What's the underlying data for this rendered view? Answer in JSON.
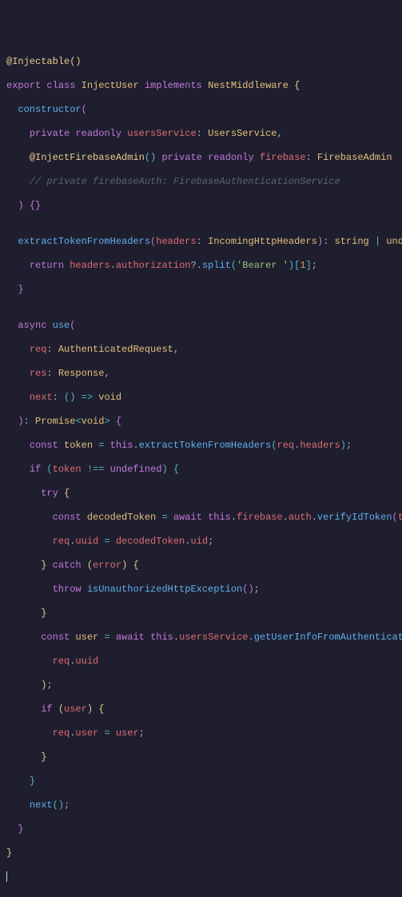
{
  "code": {
    "l1": {
      "dec": "@Injectable",
      "p1": "(",
      ")": ")"
    },
    "l2": {
      "kw1": "export",
      "kw2": "class",
      "cls": "InjectUser",
      "kw3": "implements",
      "cls2": "NestMiddleware",
      "br": "{"
    },
    "l3": {
      "fn": "constructor",
      "p": "("
    },
    "l4": {
      "kw1": "private",
      "kw2": "readonly",
      "prop": "usersService",
      "colon": ":",
      "cls": "UsersService",
      "comma": ","
    },
    "l5": {
      "dec": "@InjectFirebaseAdmin",
      "p1": "(",
      "p2": ")",
      "kw1": "private",
      "kw2": "readonly",
      "prop": "firebase",
      "colon": ":",
      "cls": "FirebaseAdmin"
    },
    "l6": {
      "cm": "// private firebaseAuth: FirebaseAuthenticationService"
    },
    "l7": {
      "p1": ")",
      "p2": "{",
      "p3": "}"
    },
    "l9": {
      "fn": "extractTokenFromHeaders",
      "p1": "(",
      "prm": "headers",
      "colon": ":",
      "cls": "IncomingHttpHeaders",
      "p2": ")",
      "colon2": ":",
      "t1": "string",
      "op": "|",
      "t2": "undefined",
      "br": "{"
    },
    "l10": {
      "kw": "return",
      "v1": "headers",
      "dot1": ".",
      "v2": "authorization",
      "q": "?",
      "dot2": ".",
      "fn": "split",
      "p1": "(",
      "str": "'Bearer '",
      "p2": ")",
      "b1": "[",
      "num": "1",
      "b2": "]",
      "semi": ";"
    },
    "l11": {
      "br": "}"
    },
    "l13": {
      "kw": "async",
      "fn": "use",
      "p": "("
    },
    "l14": {
      "prm": "req",
      "colon": ":",
      "cls": "AuthenticatedRequest",
      "comma": ","
    },
    "l15": {
      "prm": "res",
      "colon": ":",
      "cls": "Response",
      "comma": ","
    },
    "l16": {
      "prm": "next",
      "colon": ":",
      "p1": "(",
      "p2": ")",
      "arrow": "=>",
      "t": "void"
    },
    "l17": {
      "p1": ")",
      "colon": ":",
      "cls": "Promise",
      "lt": "<",
      "t": "void",
      "gt": ">",
      "br": "{"
    },
    "l18": {
      "kw": "const",
      "v": "token",
      "eq": "=",
      "th": "this",
      "dot": ".",
      "fn": "extractTokenFromHeaders",
      "p1": "(",
      "v2": "req",
      "dot2": ".",
      "v3": "headers",
      "p2": ")",
      "semi": ";"
    },
    "l19": {
      "kw": "if",
      "p1": "(",
      "v": "token",
      "op": "!==",
      "u": "undefined",
      "p2": ")",
      "br": "{"
    },
    "l20": {
      "kw": "try",
      "br": "{"
    },
    "l21": {
      "kw": "const",
      "v": "decodedToken",
      "eq": "=",
      "aw": "await",
      "th": "this",
      "d1": ".",
      "v1": "firebase",
      "d2": ".",
      "v2": "auth",
      "d3": ".",
      "fn": "verifyIdToken",
      "p1": "(",
      "a": "token",
      "p2": ")",
      "semi": ";"
    },
    "l22": {
      "v1": "req",
      "d1": ".",
      "v2": "uuid",
      "eq": "=",
      "v3": "decodedToken",
      "d2": ".",
      "v4": "uid",
      "semi": ";"
    },
    "l23": {
      "br1": "}",
      "kw": "catch",
      "p1": "(",
      "prm": "error",
      "p2": ")",
      "br2": "{"
    },
    "l24": {
      "kw": "throw",
      "fn": "isUnauthorizedHttpException",
      "p1": "(",
      "p2": ")",
      "semi": ";"
    },
    "l25": {
      "br": "}"
    },
    "l26": {
      "kw": "const",
      "v": "user",
      "eq": "=",
      "aw": "await",
      "th": "this",
      "d1": ".",
      "v1": "usersService",
      "d2": ".",
      "fn": "getUserInfoFromAuthenticationId",
      "p1": "("
    },
    "l27": {
      "v1": "req",
      "d": ".",
      "v2": "uuid"
    },
    "l28": {
      "p": ")",
      "semi": ";"
    },
    "l29": {
      "kw": "if",
      "p1": "(",
      "v": "user",
      "p2": ")",
      "br": "{"
    },
    "l30": {
      "v1": "req",
      "d": ".",
      "v2": "user",
      "eq": "=",
      "v3": "user",
      "semi": ";"
    },
    "l31": {
      "br": "}"
    },
    "l32": {
      "br": "}"
    },
    "l33": {
      "fn": "next",
      "p1": "(",
      "p2": ")",
      "semi": ";"
    },
    "l34": {
      "br": "}"
    },
    "l35": {
      "br": "}"
    }
  }
}
